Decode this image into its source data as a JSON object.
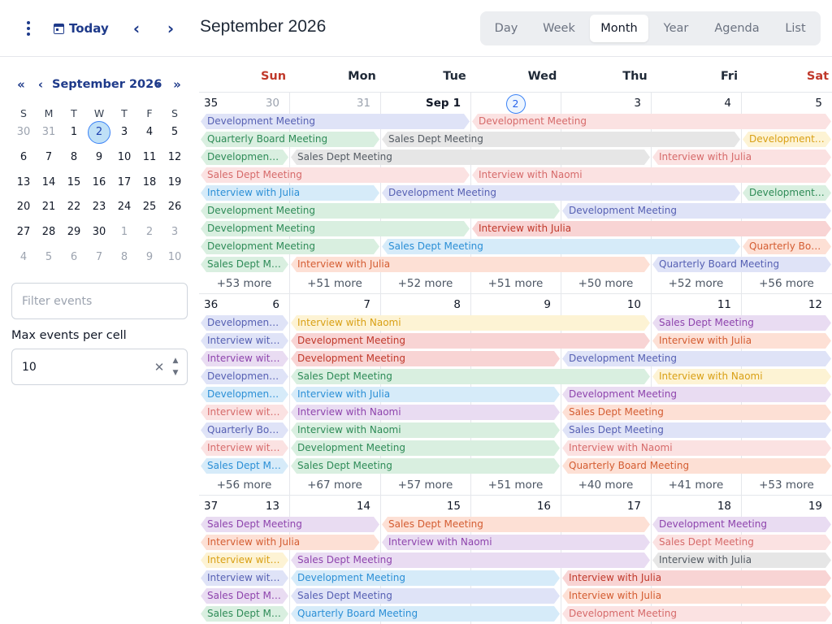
{
  "toolbar": {
    "today_label": "Today",
    "title": "September 2026",
    "views": [
      "Day",
      "Week",
      "Month",
      "Year",
      "Agenda",
      "List"
    ],
    "active_view": "Month"
  },
  "mini_calendar": {
    "title": "September 2026",
    "weekday_headers": [
      "S",
      "M",
      "T",
      "W",
      "T",
      "F",
      "S"
    ],
    "weeks": [
      [
        "30",
        "31",
        "1",
        "2",
        "3",
        "4",
        "5"
      ],
      [
        "6",
        "7",
        "8",
        "9",
        "10",
        "11",
        "12"
      ],
      [
        "13",
        "14",
        "15",
        "16",
        "17",
        "18",
        "19"
      ],
      [
        "20",
        "21",
        "22",
        "23",
        "24",
        "25",
        "26"
      ],
      [
        "27",
        "28",
        "29",
        "30",
        "1",
        "2",
        "3"
      ],
      [
        "4",
        "5",
        "6",
        "7",
        "8",
        "9",
        "10"
      ]
    ],
    "today": "2"
  },
  "filter": {
    "placeholder": "Filter events",
    "value": ""
  },
  "max_events": {
    "label": "Max events per cell",
    "value": "10"
  },
  "colors": {
    "lavender": "#dfe3f7",
    "lavender_text": "#5660b3",
    "green": "#d9efe0",
    "green_text": "#2e8b57",
    "pink": "#fbe2e2",
    "pink_text": "#d66a6a",
    "salmon": "#fde0d5",
    "salmon_text": "#d45d32",
    "red": "#f8d4d4",
    "red_text": "#c0392b",
    "grey": "#e6e6e6",
    "grey_text": "#545b63",
    "yellow": "#fdf3d4",
    "yellow_text": "#d9a015",
    "blue": "#d6ebf9",
    "blue_text": "#2b8fd6",
    "purple": "#e9dcf2",
    "purple_text": "#8e44ad"
  },
  "calendar": {
    "weekday_headers": [
      "Sun",
      "Mon",
      "Tue",
      "Wed",
      "Thu",
      "Fri",
      "Sat"
    ],
    "weeks": [
      {
        "week_number": "35",
        "days": [
          {
            "label": "30",
            "muted": true
          },
          {
            "label": "31",
            "muted": true
          },
          {
            "label": "1",
            "month_label": "Sep",
            "first": true
          },
          {
            "label": "2",
            "today": true
          },
          {
            "label": "3"
          },
          {
            "label": "4"
          },
          {
            "label": "5"
          }
        ],
        "events": [
          {
            "title": "Development Meeting",
            "start": 0,
            "span": 3,
            "row": 0,
            "color": "lavender"
          },
          {
            "title": "Development Meeting",
            "start": 3,
            "span": 4,
            "row": 0,
            "color": "pink"
          },
          {
            "title": "Quarterly Board Meeting",
            "start": 0,
            "span": 2,
            "row": 1,
            "color": "green"
          },
          {
            "title": "Sales Dept Meeting",
            "start": 2,
            "span": 4,
            "row": 1,
            "color": "grey"
          },
          {
            "title": "Development Meeting",
            "start": 6,
            "span": 1,
            "row": 1,
            "color": "yellow"
          },
          {
            "title": "Development Meeting",
            "start": 0,
            "span": 1,
            "row": 2,
            "color": "green"
          },
          {
            "title": "Sales Dept Meeting",
            "start": 1,
            "span": 4,
            "row": 2,
            "color": "grey"
          },
          {
            "title": "Interview with Julia",
            "start": 5,
            "span": 2,
            "row": 2,
            "color": "pink"
          },
          {
            "title": "Sales Dept Meeting",
            "start": 0,
            "span": 3,
            "row": 3,
            "color": "pink"
          },
          {
            "title": "Interview with Naomi",
            "start": 3,
            "span": 4,
            "row": 3,
            "color": "pink"
          },
          {
            "title": "Interview with Julia",
            "start": 0,
            "span": 2,
            "row": 4,
            "color": "blue"
          },
          {
            "title": "Development Meeting",
            "start": 2,
            "span": 4,
            "row": 4,
            "color": "lavender"
          },
          {
            "title": "Development Meeting",
            "start": 6,
            "span": 1,
            "row": 4,
            "color": "green"
          },
          {
            "title": "Development Meeting",
            "start": 0,
            "span": 4,
            "row": 5,
            "color": "green"
          },
          {
            "title": "Development Meeting",
            "start": 4,
            "span": 3,
            "row": 5,
            "color": "lavender"
          },
          {
            "title": "Development Meeting",
            "start": 0,
            "span": 3,
            "row": 6,
            "color": "green"
          },
          {
            "title": "Interview with Julia",
            "start": 3,
            "span": 4,
            "row": 6,
            "color": "red"
          },
          {
            "title": "Development Meeting",
            "start": 0,
            "span": 2,
            "row": 7,
            "color": "green"
          },
          {
            "title": "Sales Dept Meeting",
            "start": 2,
            "span": 4,
            "row": 7,
            "color": "blue"
          },
          {
            "title": "Quarterly Board Meeting",
            "start": 6,
            "span": 1,
            "row": 7,
            "color": "salmon"
          },
          {
            "title": "Sales Dept Meeting",
            "start": 0,
            "span": 1,
            "row": 8,
            "color": "green"
          },
          {
            "title": "Interview with Julia",
            "start": 1,
            "span": 4,
            "row": 8,
            "color": "salmon"
          },
          {
            "title": "Quarterly Board Meeting",
            "start": 5,
            "span": 2,
            "row": 8,
            "color": "lavender"
          }
        ],
        "more": [
          "+53 more",
          "+51 more",
          "+52 more",
          "+51 more",
          "+50 more",
          "+52 more",
          "+56 more"
        ]
      },
      {
        "week_number": "36",
        "days": [
          {
            "label": "6"
          },
          {
            "label": "7"
          },
          {
            "label": "8"
          },
          {
            "label": "9"
          },
          {
            "label": "10"
          },
          {
            "label": "11"
          },
          {
            "label": "12"
          }
        ],
        "events": [
          {
            "title": "Development Meeting",
            "start": 0,
            "span": 1,
            "row": 0,
            "color": "lavender"
          },
          {
            "title": "Interview with Naomi",
            "start": 1,
            "span": 4,
            "row": 0,
            "color": "yellow"
          },
          {
            "title": "Sales Dept Meeting",
            "start": 5,
            "span": 2,
            "row": 0,
            "color": "purple"
          },
          {
            "title": "Interview with Julia",
            "start": 0,
            "span": 1,
            "row": 1,
            "color": "lavender"
          },
          {
            "title": "Development Meeting",
            "start": 1,
            "span": 4,
            "row": 1,
            "color": "red"
          },
          {
            "title": "Interview with Julia",
            "start": 5,
            "span": 2,
            "row": 1,
            "color": "salmon"
          },
          {
            "title": "Interview with Naomi",
            "start": 0,
            "span": 1,
            "row": 2,
            "color": "purple"
          },
          {
            "title": "Development Meeting",
            "start": 1,
            "span": 3,
            "row": 2,
            "color": "red"
          },
          {
            "title": "Development Meeting",
            "start": 4,
            "span": 3,
            "row": 2,
            "color": "lavender"
          },
          {
            "title": "Development Meeting",
            "start": 0,
            "span": 1,
            "row": 3,
            "color": "lavender"
          },
          {
            "title": "Sales Dept Meeting",
            "start": 1,
            "span": 4,
            "row": 3,
            "color": "green"
          },
          {
            "title": "Interview with Naomi",
            "start": 5,
            "span": 2,
            "row": 3,
            "color": "yellow"
          },
          {
            "title": "Development Meeting",
            "start": 0,
            "span": 1,
            "row": 4,
            "color": "blue"
          },
          {
            "title": "Interview with Julia",
            "start": 1,
            "span": 3,
            "row": 4,
            "color": "blue"
          },
          {
            "title": "Development Meeting",
            "start": 4,
            "span": 3,
            "row": 4,
            "color": "purple"
          },
          {
            "title": "Interview with Naomi",
            "start": 0,
            "span": 1,
            "row": 5,
            "color": "pink"
          },
          {
            "title": "Interview with Naomi",
            "start": 1,
            "span": 3,
            "row": 5,
            "color": "purple"
          },
          {
            "title": "Sales Dept Meeting",
            "start": 4,
            "span": 3,
            "row": 5,
            "color": "salmon"
          },
          {
            "title": "Quarterly Board Meeting",
            "start": 0,
            "span": 1,
            "row": 6,
            "color": "lavender"
          },
          {
            "title": "Interview with Naomi",
            "start": 1,
            "span": 3,
            "row": 6,
            "color": "green"
          },
          {
            "title": "Sales Dept Meeting",
            "start": 4,
            "span": 3,
            "row": 6,
            "color": "lavender"
          },
          {
            "title": "Interview with Julia",
            "start": 0,
            "span": 1,
            "row": 7,
            "color": "pink"
          },
          {
            "title": "Development Meeting",
            "start": 1,
            "span": 3,
            "row": 7,
            "color": "green"
          },
          {
            "title": "Interview with Naomi",
            "start": 4,
            "span": 3,
            "row": 7,
            "color": "pink"
          },
          {
            "title": "Sales Dept Meeting",
            "start": 0,
            "span": 1,
            "row": 8,
            "color": "blue"
          },
          {
            "title": "Sales Dept Meeting",
            "start": 1,
            "span": 3,
            "row": 8,
            "color": "green"
          },
          {
            "title": "Quarterly Board Meeting",
            "start": 4,
            "span": 3,
            "row": 8,
            "color": "salmon"
          }
        ],
        "more": [
          "+56 more",
          "+67 more",
          "+57 more",
          "+51 more",
          "+40 more",
          "+41 more",
          "+53 more"
        ]
      },
      {
        "week_number": "37",
        "days": [
          {
            "label": "13"
          },
          {
            "label": "14"
          },
          {
            "label": "15"
          },
          {
            "label": "16"
          },
          {
            "label": "17"
          },
          {
            "label": "18"
          },
          {
            "label": "19"
          }
        ],
        "events": [
          {
            "title": "Sales Dept Meeting",
            "start": 0,
            "span": 2,
            "row": 0,
            "color": "purple"
          },
          {
            "title": "Sales Dept Meeting",
            "start": 2,
            "span": 3,
            "row": 0,
            "color": "salmon"
          },
          {
            "title": "Development Meeting",
            "start": 5,
            "span": 2,
            "row": 0,
            "color": "purple"
          },
          {
            "title": "Interview with Julia",
            "start": 0,
            "span": 2,
            "row": 1,
            "color": "salmon"
          },
          {
            "title": "Interview with Naomi",
            "start": 2,
            "span": 3,
            "row": 1,
            "color": "purple"
          },
          {
            "title": "Sales Dept Meeting",
            "start": 5,
            "span": 2,
            "row": 1,
            "color": "pink"
          },
          {
            "title": "Interview with Julia",
            "start": 0,
            "span": 1,
            "row": 2,
            "color": "yellow"
          },
          {
            "title": "Sales Dept Meeting",
            "start": 1,
            "span": 4,
            "row": 2,
            "color": "purple"
          },
          {
            "title": "Interview with Julia",
            "start": 5,
            "span": 2,
            "row": 2,
            "color": "grey"
          },
          {
            "title": "Interview with Naomi",
            "start": 0,
            "span": 1,
            "row": 3,
            "color": "lavender"
          },
          {
            "title": "Development Meeting",
            "start": 1,
            "span": 3,
            "row": 3,
            "color": "blue"
          },
          {
            "title": "Interview with Julia",
            "start": 4,
            "span": 3,
            "row": 3,
            "color": "red"
          },
          {
            "title": "Sales Dept Meeting",
            "start": 0,
            "span": 1,
            "row": 4,
            "color": "purple"
          },
          {
            "title": "Sales Dept Meeting",
            "start": 1,
            "span": 3,
            "row": 4,
            "color": "lavender"
          },
          {
            "title": "Interview with Julia",
            "start": 4,
            "span": 3,
            "row": 4,
            "color": "salmon"
          },
          {
            "title": "Sales Dept Meeting",
            "start": 0,
            "span": 1,
            "row": 5,
            "color": "green"
          },
          {
            "title": "Quarterly Board Meeting",
            "start": 1,
            "span": 3,
            "row": 5,
            "color": "blue"
          },
          {
            "title": "Development Meeting",
            "start": 4,
            "span": 3,
            "row": 5,
            "color": "pink"
          }
        ],
        "more": []
      }
    ]
  }
}
